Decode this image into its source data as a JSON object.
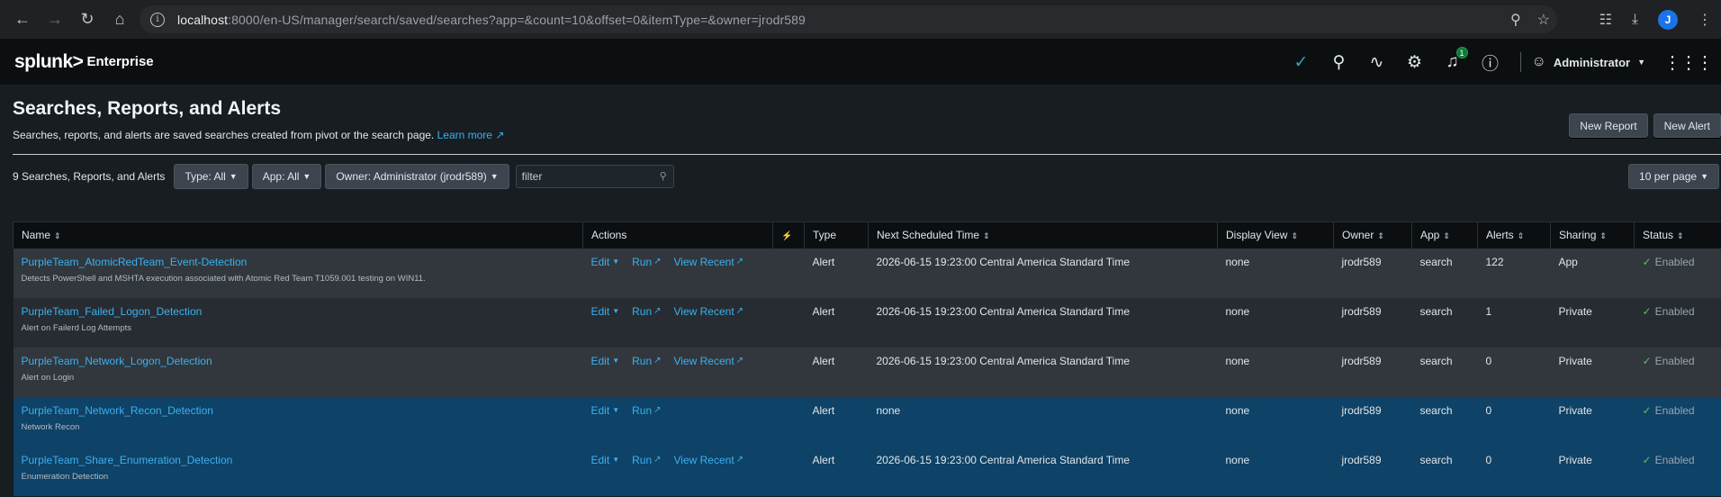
{
  "browser": {
    "url_host": "localhost",
    "url_rest": ":8000/en-US/manager/search/saved/searches?app=&count=10&offset=0&itemType=&owner=jrodr589",
    "profile_initial": "J"
  },
  "header": {
    "logo": "splunk>",
    "product": "Enterprise",
    "notification_count": "1",
    "user": "Administrator"
  },
  "page": {
    "title": "Searches, Reports, and Alerts",
    "description": "Searches, reports, and alerts are saved searches created from pivot or the search page.",
    "learn_more": "Learn more",
    "new_report": "New Report",
    "new_alert": "New Alert"
  },
  "filters": {
    "count_label": "9 Searches, Reports, and Alerts",
    "type": "Type: All",
    "app": "App: All",
    "owner": "Owner: Administrator (jrodr589)",
    "filter_placeholder": "filter",
    "per_page": "10 per page"
  },
  "table": {
    "columns": {
      "name": "Name",
      "actions": "Actions",
      "type": "Type",
      "next_scheduled": "Next Scheduled Time",
      "display_view": "Display View",
      "owner": "Owner",
      "app": "App",
      "alerts": "Alerts",
      "sharing": "Sharing",
      "status": "Status"
    },
    "action_labels": {
      "edit": "Edit",
      "run": "Run",
      "view_recent": "View Recent"
    },
    "rows": [
      {
        "name": "PurpleTeam_AtomicRedTeam_Event-Detection",
        "description": "Detects PowerShell and MSHTA execution associated with Atomic Red Team T1059.001 testing on WIN11.",
        "type": "Alert",
        "next_scheduled": "2026-06-15 19:23:00 Central America Standard Time",
        "display_view": "none",
        "owner": "jrodr589",
        "app": "search",
        "alerts": "122",
        "sharing": "App",
        "status": "Enabled",
        "has_view_recent": true
      },
      {
        "name": "PurpleTeam_Failed_Logon_Detection",
        "description": "Alert on Failerd Log Attempts",
        "type": "Alert",
        "next_scheduled": "2026-06-15 19:23:00 Central America Standard Time",
        "display_view": "none",
        "owner": "jrodr589",
        "app": "search",
        "alerts": "1",
        "sharing": "Private",
        "status": "Enabled",
        "has_view_recent": true
      },
      {
        "name": "PurpleTeam_Network_Logon_Detection",
        "description": "Alert on Login",
        "type": "Alert",
        "next_scheduled": "2026-06-15 19:23:00 Central America Standard Time",
        "display_view": "none",
        "owner": "jrodr589",
        "app": "search",
        "alerts": "0",
        "sharing": "Private",
        "status": "Enabled",
        "has_view_recent": true
      },
      {
        "name": "PurpleTeam_Network_Recon_Detection",
        "description": "Network Recon",
        "type": "Alert",
        "next_scheduled": "none",
        "display_view": "none",
        "owner": "jrodr589",
        "app": "search",
        "alerts": "0",
        "sharing": "Private",
        "status": "Enabled",
        "has_view_recent": false
      },
      {
        "name": "PurpleTeam_Share_Enumeration_Detection",
        "description": "Enumeration Detection",
        "type": "Alert",
        "next_scheduled": "2026-06-15 19:23:00 Central America Standard Time",
        "display_view": "none",
        "owner": "jrodr589",
        "app": "search",
        "alerts": "0",
        "sharing": "Private",
        "status": "Enabled",
        "has_view_recent": true
      }
    ]
  },
  "colors": {
    "link": "#3cb0f0",
    "selected_row": "#0e4266",
    "enabled_check": "#5cc05c"
  }
}
